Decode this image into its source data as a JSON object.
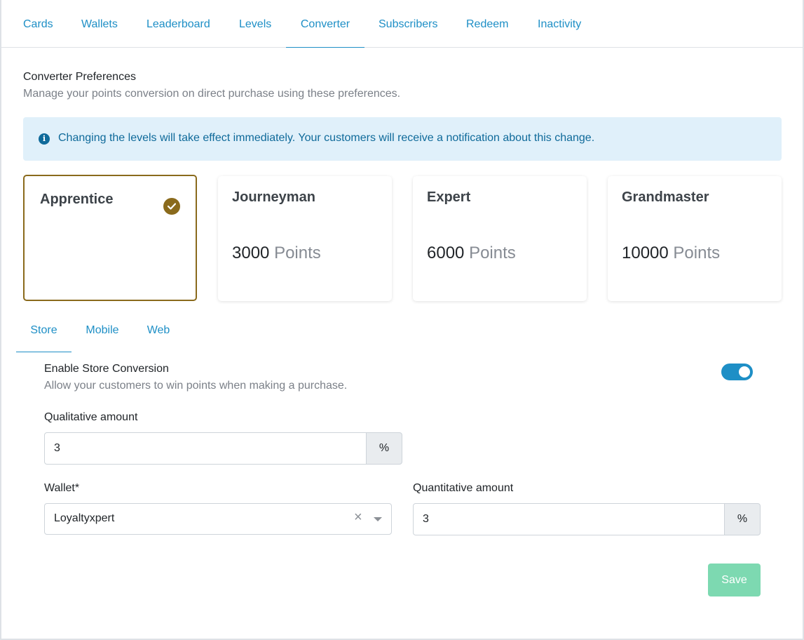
{
  "tabs": [
    "Cards",
    "Wallets",
    "Leaderboard",
    "Levels",
    "Converter",
    "Subscribers",
    "Redeem",
    "Inactivity"
  ],
  "active_tab": "Converter",
  "header": {
    "title": "Converter Preferences",
    "subtitle": "Manage your points conversion on direct purchase using these preferences."
  },
  "alert": {
    "icon": "info-icon",
    "text": "Changing the levels will take effect immediately. Your customers will receive a notification about this change."
  },
  "levels": [
    {
      "name": "Apprentice",
      "points": "",
      "unit": "",
      "selected": true
    },
    {
      "name": "Journeyman",
      "points": "3000",
      "unit": "Points",
      "selected": false
    },
    {
      "name": "Expert",
      "points": "6000",
      "unit": "Points",
      "selected": false
    },
    {
      "name": "Grandmaster",
      "points": "10000",
      "unit": "Points",
      "selected": false
    }
  ],
  "subtabs": [
    "Store",
    "Mobile",
    "Web"
  ],
  "active_subtab": "Store",
  "store": {
    "enable_title": "Enable Store Conversion",
    "enable_desc": "Allow your customers to win points when making a purchase.",
    "enabled": true,
    "qualitative_label": "Qualitative amount",
    "qualitative_value": "3",
    "qualitative_unit": "%",
    "wallet_label": "Wallet*",
    "wallet_value": "Loyaltyxpert",
    "quantitative_label": "Quantitative amount",
    "quantitative_value": "3",
    "quantitative_unit": "%"
  },
  "save_label": "Save",
  "colors": {
    "accent": "#1e8fc6",
    "selected_level": "#8a6a1c",
    "alert_bg": "#e0f0fa",
    "save_disabled": "#7dd9b1"
  }
}
